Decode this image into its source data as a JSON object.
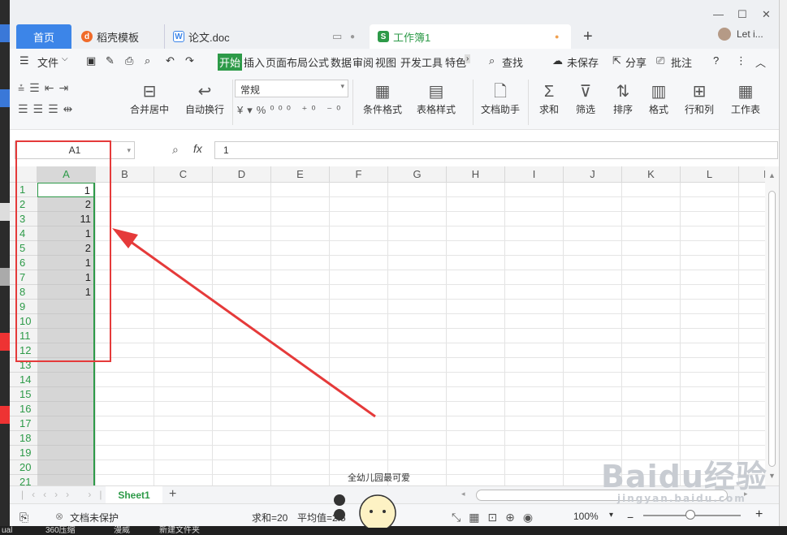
{
  "tabs": {
    "home": "首页",
    "template": "稻壳模板",
    "doc": "论文.doc",
    "workbook": "工作簿1",
    "user": "Let i..."
  },
  "menu": {
    "file": "文件",
    "items": [
      "开始",
      "插入",
      "页面布局",
      "公式",
      "数据",
      "审阅",
      "视图",
      "开发工具",
      "特色"
    ],
    "find": "查找",
    "unsaved": "未保存",
    "share": "分享",
    "comment": "批注"
  },
  "ribbon": {
    "merge": "合并居中",
    "wrap": "自动换行",
    "format_select": "常规",
    "cond_format": "条件格式",
    "table_style": "表格样式",
    "doc_assist": "文档助手",
    "sum": "求和",
    "filter": "筛选",
    "sort": "排序",
    "format": "格式",
    "rowcol": "行和列",
    "worksheet": "工作表"
  },
  "formula": {
    "cell_ref": "A1",
    "fx": "fx",
    "value": "1"
  },
  "grid": {
    "columns": [
      "A",
      "B",
      "C",
      "D",
      "E",
      "F",
      "G",
      "H",
      "I",
      "J",
      "K",
      "L",
      "M"
    ],
    "rows": [
      "1",
      "2",
      "3",
      "4",
      "5",
      "6",
      "7",
      "8",
      "9",
      "10",
      "11",
      "12",
      "13",
      "14",
      "15",
      "16",
      "17",
      "18",
      "19",
      "20",
      "21"
    ],
    "colA": [
      "1",
      "2",
      "11",
      "1",
      "2",
      "1",
      "1",
      "1"
    ]
  },
  "sheet": {
    "name": "Sheet1"
  },
  "status": {
    "protect": "文档未保护",
    "sum": "求和=20",
    "avg": "平均值=2.5",
    "zoom": "100%"
  },
  "desktop": {
    "b1": "ual",
    "b2": "360压缩",
    "b3": "漫威",
    "b4": "新建文件夹"
  },
  "watermark": {
    "brand": "Baidu经验",
    "url": "jingyan.baidu.com"
  },
  "sticker": {
    "text": "全幼儿园最可爱"
  }
}
